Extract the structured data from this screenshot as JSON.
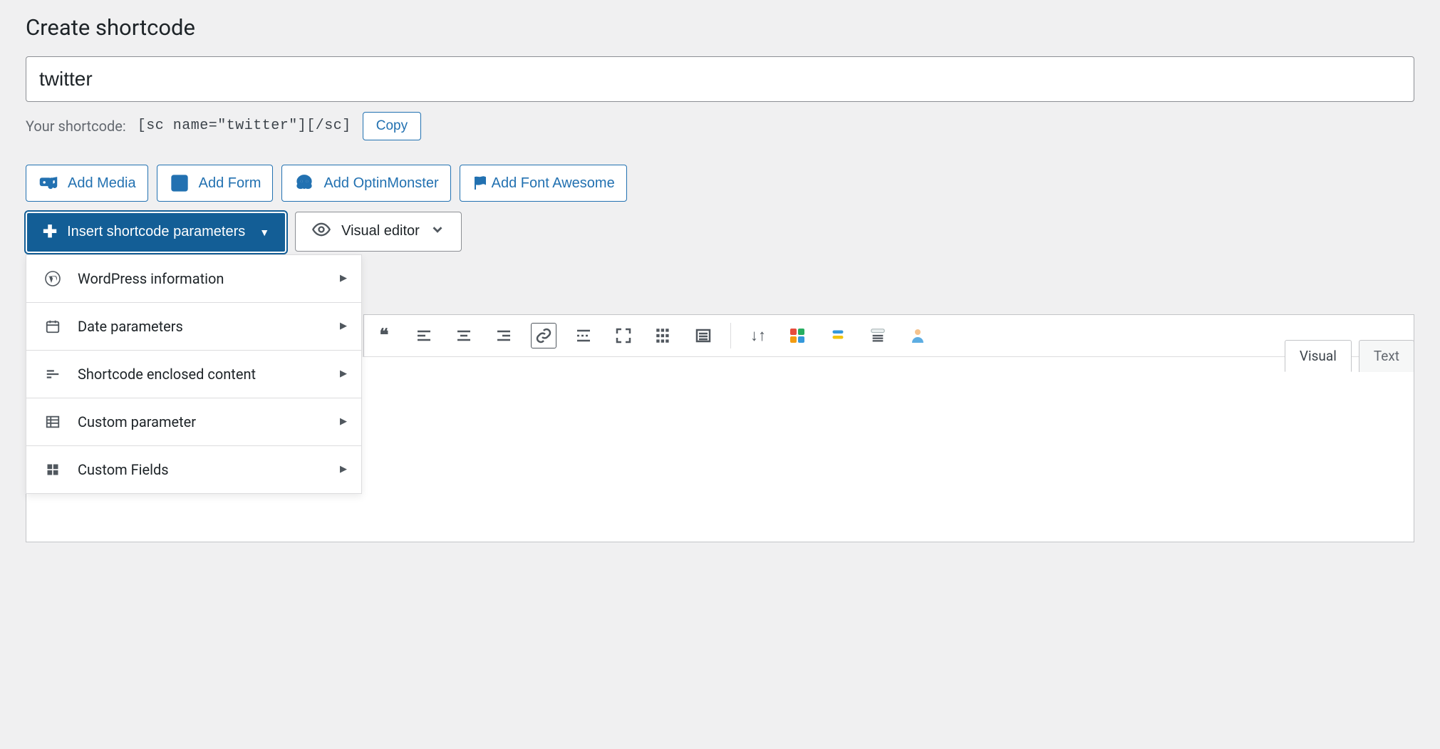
{
  "page": {
    "title": "Create shortcode",
    "shortcode_name": "twitter",
    "shortcode_label": "Your shortcode:",
    "shortcode_code": "[sc name=\"twitter\"][/sc]",
    "copy_label": "Copy"
  },
  "actions": {
    "add_media": "Add Media",
    "add_form": "Add Form",
    "add_optinmonster": "Add OptinMonster",
    "add_fontawesome": "Add Font Awesome"
  },
  "insert": {
    "label": "Insert shortcode parameters",
    "items": {
      "wp_info": "WordPress information",
      "date_params": "Date parameters",
      "enclosed": "Shortcode enclosed content",
      "custom_param": "Custom parameter",
      "custom_fields": "Custom Fields"
    }
  },
  "editor": {
    "visual_label": "Visual editor",
    "tab_visual": "Visual",
    "tab_text": "Text"
  }
}
